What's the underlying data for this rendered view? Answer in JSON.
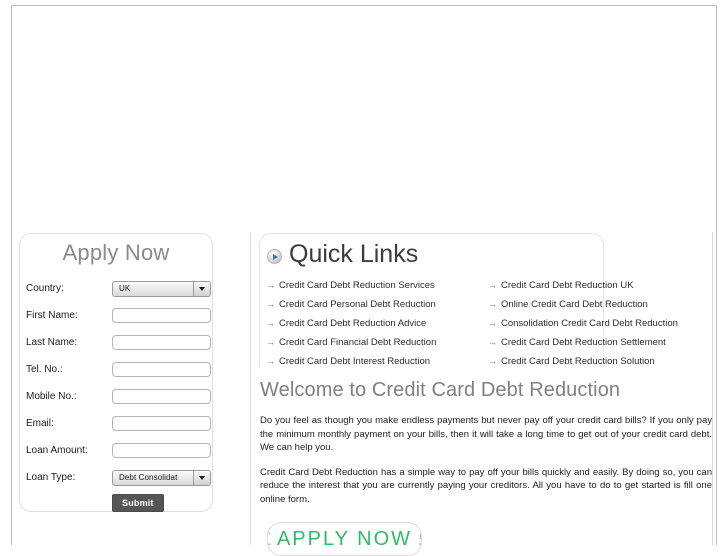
{
  "apply_panel": {
    "title": "Apply Now",
    "fields": [
      {
        "label": "Country:",
        "type": "select",
        "value": "UK"
      },
      {
        "label": "First Name:",
        "type": "text",
        "value": ""
      },
      {
        "label": "Last Name:",
        "type": "text",
        "value": ""
      },
      {
        "label": "Tel. No.:",
        "type": "text",
        "value": ""
      },
      {
        "label": "Mobile No.:",
        "type": "text",
        "value": ""
      },
      {
        "label": "Email:",
        "type": "text",
        "value": ""
      },
      {
        "label": "Loan Amount:",
        "type": "text",
        "value": ""
      },
      {
        "label": "Loan Type:",
        "type": "select",
        "value": "Debt Consolidat"
      }
    ],
    "submit_label": "Submit"
  },
  "quick_links": {
    "heading": "Quick Links",
    "bullet_icon": "play-circle-icon",
    "arrow_glyph": "→",
    "items": [
      "Credit Card Debt Reduction Services",
      "Credit Card Debt Reduction UK",
      "Credit Card Personal Debt Reduction",
      "Online Credit Card Debt Reduction",
      "Credit Card Debt Reduction Advice",
      "Consolidation Credit Card Debt Reduction",
      "Credit Card Financial Debt Reduction",
      "Credit Card Debt Reduction Settlement",
      "Credit Card Debt Interest Reduction",
      "Credit Card Debt Reduction Solution"
    ]
  },
  "welcome": {
    "title": "Welcome to Credit Card Debt Reduction",
    "paragraph1": "Do you feel as though you make endless payments but never pay off your credit card bills? If you only pay the minimum monthly payment on your bills, then it will take a long time to get out of your credit card debt. We can help you.",
    "paragraph2": "Credit Card Debt Reduction has a simple way to pay off your bills quickly and easily. By doing so, you can reduce the interest that you are currently paying your creditors. All you have to do to get started is fill one online form."
  },
  "cta": {
    "left_symbol": "£",
    "label": "APPLY NOW",
    "right_symbol": "£"
  },
  "colors": {
    "cta_green": "#2fbb63",
    "heading_gray": "#808080",
    "submit_bg": "#555555"
  }
}
